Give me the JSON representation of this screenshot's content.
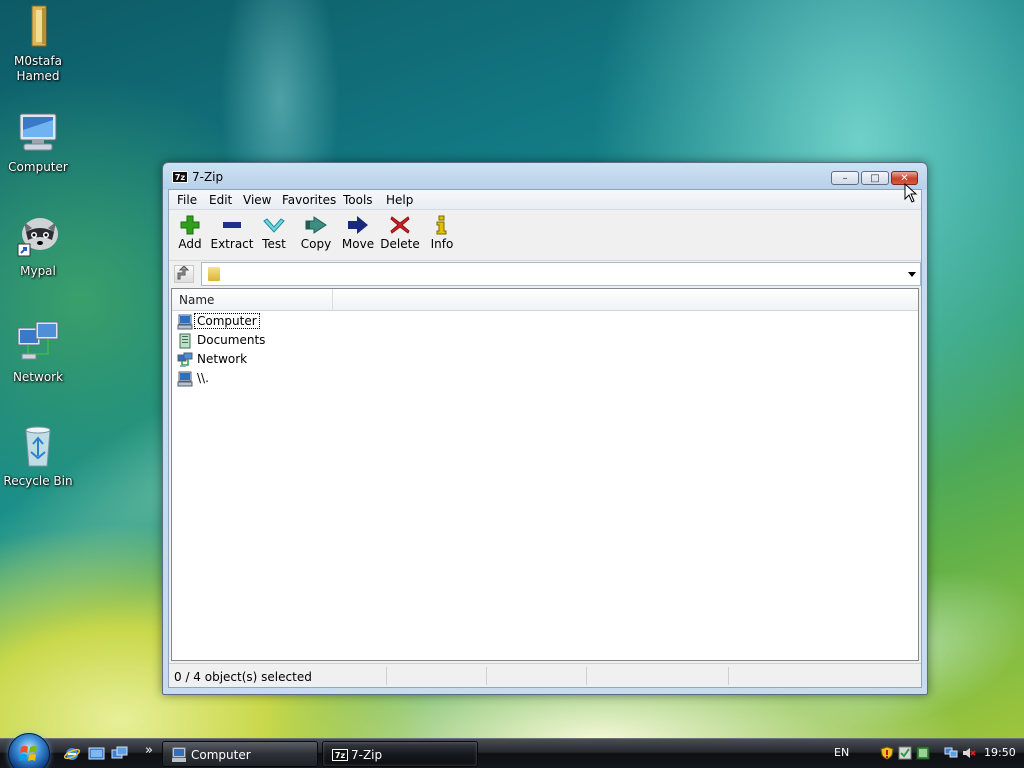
{
  "desktop": {
    "icons": [
      {
        "label": "M0stafa\nHamed",
        "icon": "folder-icon"
      },
      {
        "label": "Computer",
        "icon": "computer-icon"
      },
      {
        "label": "Mypal",
        "icon": "raccoon-shortcut-icon"
      },
      {
        "label": "Network",
        "icon": "network-icon"
      },
      {
        "label": "Recycle Bin",
        "icon": "recycle-bin-icon"
      }
    ]
  },
  "window": {
    "title": "7-Zip",
    "app_badge": "7z",
    "controls": {
      "minimize": "–",
      "maximize": "□",
      "close": "✕"
    },
    "menu": [
      "File",
      "Edit",
      "View",
      "Favorites",
      "Tools",
      "Help"
    ],
    "toolbar": [
      {
        "label": "Add",
        "icon": "plus-icon",
        "color": "#2ea11b"
      },
      {
        "label": "Extract",
        "icon": "minus-icon",
        "color": "#1f2f8c"
      },
      {
        "label": "Test",
        "icon": "checkmark-icon",
        "color": "#33b8c8"
      },
      {
        "label": "Copy",
        "icon": "double-arrow-icon",
        "color": "#1f8c6e"
      },
      {
        "label": "Move",
        "icon": "arrow-right-icon",
        "color": "#1a2a7a"
      },
      {
        "label": "Delete",
        "icon": "x-icon",
        "color": "#d42020"
      },
      {
        "label": "Info",
        "icon": "info-icon",
        "color": "#e0c000"
      }
    ],
    "address": {
      "value": ""
    },
    "list": {
      "columns": [
        "Name"
      ],
      "rows": [
        {
          "name": "Computer",
          "icon": "computer-icon"
        },
        {
          "name": "Documents",
          "icon": "documents-icon"
        },
        {
          "name": "Network",
          "icon": "network-icon"
        },
        {
          "name": "\\\\.",
          "icon": "computer-icon"
        }
      ]
    },
    "status": [
      "0 / 4 object(s) selected",
      "",
      "",
      ""
    ]
  },
  "taskbar": {
    "buttons": [
      {
        "label": "Computer",
        "icon": "computer-icon",
        "active": false
      },
      {
        "label": "7-Zip",
        "icon": "7zip-icon",
        "active": true
      }
    ],
    "overflow": "»",
    "language": "EN",
    "clock": "19:50"
  }
}
